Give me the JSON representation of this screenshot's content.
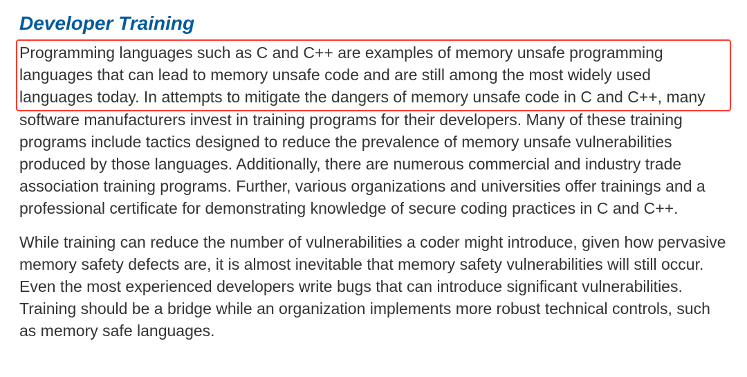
{
  "section": {
    "heading": "Developer Training",
    "paragraph1": "Programming languages such as C and C++ are examples of memory unsafe programming languages that can lead to memory unsafe code and are still among the most widely used languages today. In attempts to mitigate the dangers of memory unsafe code in C and C++, many software manufacturers invest in training programs for their developers. Many of these training programs include tactics designed to reduce the prevalence of memory unsafe vulnerabilities produced by those languages. Additionally, there are numerous commercial and industry trade association training programs. Further, various organizations and universities offer trainings and a professional certificate for demonstrating knowledge of secure coding practices in C and C++.",
    "paragraph2": "While training can reduce the number of vulnerabilities a coder might introduce, given how pervasive memory safety defects are, it is almost inevitable that memory safety vulnerabilities will still occur. Even the most experienced developers write bugs that can introduce significant vulnerabilities. Training should be a bridge while an organization implements more robust technical controls, such as memory safe languages."
  }
}
